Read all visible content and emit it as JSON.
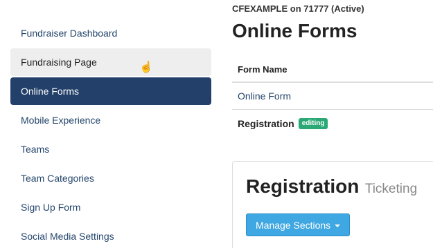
{
  "sidebar": {
    "items": [
      {
        "label": "Fundraiser Dashboard"
      },
      {
        "label": "Fundraising Page"
      },
      {
        "label": "Online Forms"
      },
      {
        "label": "Mobile Experience"
      },
      {
        "label": "Teams"
      },
      {
        "label": "Team Categories"
      },
      {
        "label": "Sign Up Form"
      },
      {
        "label": "Social Media Settings"
      }
    ],
    "active_index": 2,
    "hover_index": 1
  },
  "header": {
    "account_line": "CFEXAMPLE on 71777 (Active)",
    "title": "Online Forms"
  },
  "forms_table": {
    "column_header": "Form Name",
    "rows": [
      {
        "name": "Online Form"
      },
      {
        "name": "Registration",
        "badge": "editing"
      }
    ]
  },
  "panel": {
    "title": "Registration",
    "subtitle": "Ticketing",
    "manage_button": "Manage Sections"
  },
  "colors": {
    "active_nav": "#23406a",
    "link": "#23446b",
    "badge": "#2aa876",
    "button": "#3fa7e1"
  },
  "icons": {
    "cursor": "hand-pointer-icon",
    "caret": "caret-down-icon"
  }
}
